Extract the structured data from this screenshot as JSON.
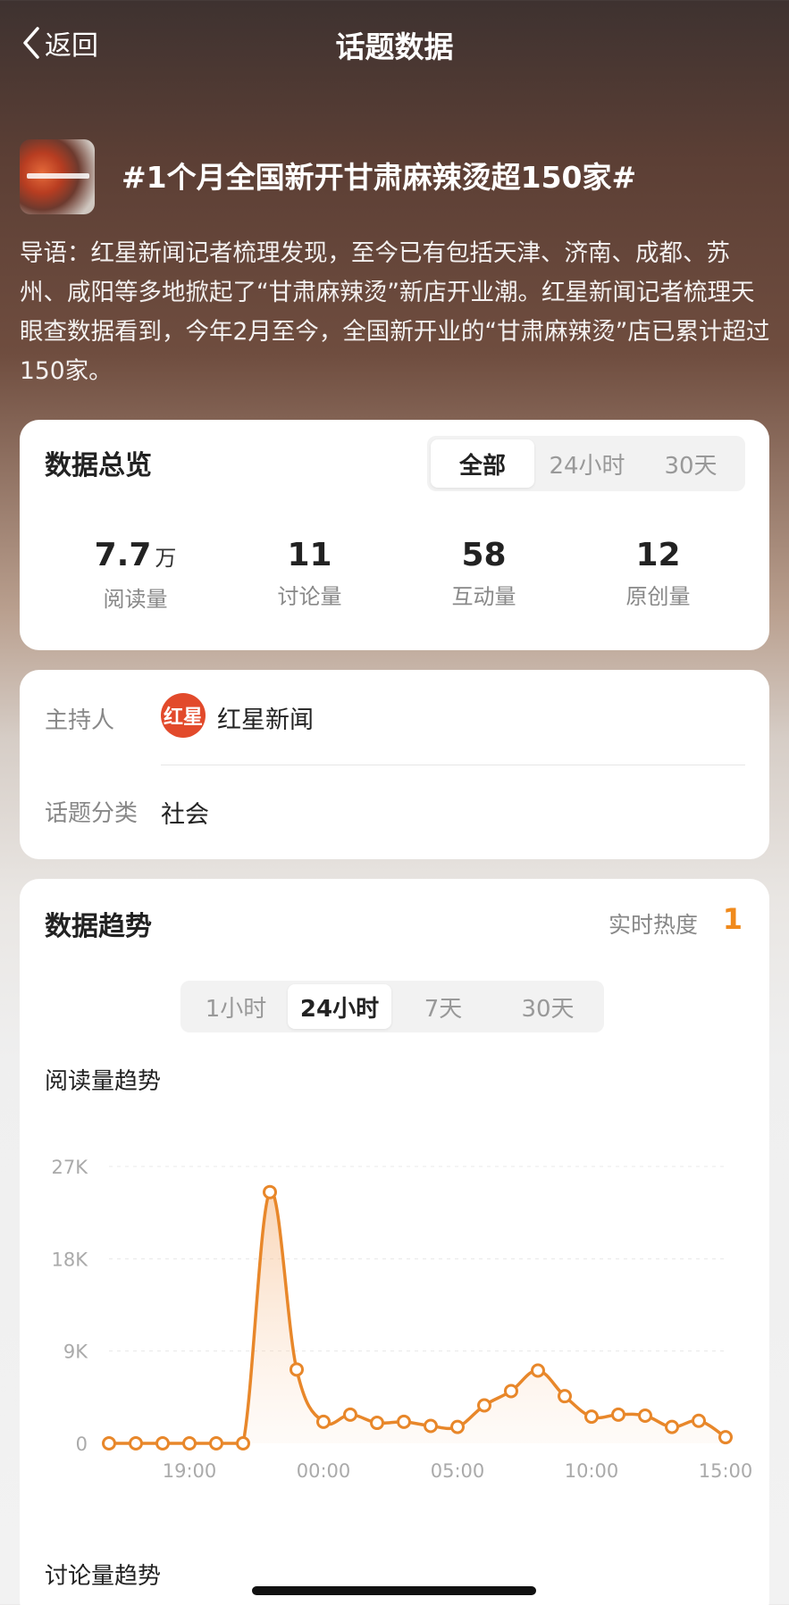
{
  "nav": {
    "back_label": "返回",
    "title": "话题数据"
  },
  "topic": {
    "title": "#1个月全国新开甘肃麻辣烫超150家#",
    "intro": "导语：红星新闻记者梳理发现，至今已有包括天津、济南、成都、苏州、咸阳等多地掀起了“甘肃麻辣烫”新店开业潮。红星新闻记者梳理天眼查数据看到，今年2月至今，全国新开业的“甘肃麻辣烫”店已累计超过150家。"
  },
  "overview": {
    "title": "数据总览",
    "tabs": [
      "全部",
      "24小时",
      "30天"
    ],
    "active_tab": "全部",
    "stats": [
      {
        "value": "7.7",
        "unit": "万",
        "label": "阅读量"
      },
      {
        "value": "11",
        "unit": "",
        "label": "讨论量"
      },
      {
        "value": "58",
        "unit": "",
        "label": "互动量"
      },
      {
        "value": "12",
        "unit": "",
        "label": "原创量"
      }
    ]
  },
  "host_info": {
    "host_label": "主持人",
    "host_logo_text": "红星",
    "host_name": "红星新闻",
    "category_label": "话题分类",
    "category_value": "社会"
  },
  "trend": {
    "title": "数据趋势",
    "heat_label": "实时热度",
    "heat_rank": "1",
    "tabs": [
      "1小时",
      "24小时",
      "7天",
      "30天"
    ],
    "active_tab": "24小时",
    "read_trend_title": "阅读量趋势",
    "discussion_trend_title": "讨论量趋势"
  },
  "colors": {
    "accent": "#f08a1c",
    "line": "#e8872a"
  },
  "chart_data": {
    "type": "area",
    "title": "阅读量趋势",
    "y_ticks": [
      "27K",
      "18K",
      "9K",
      "0"
    ],
    "ylim": [
      0,
      27000
    ],
    "x_tick_labels": [
      "19:00",
      "00:00",
      "05:00",
      "10:00",
      "15:00"
    ],
    "grid": true,
    "series": [
      {
        "values": [
          0,
          0,
          0,
          0,
          0,
          0,
          24500,
          7200,
          2100,
          2800,
          2000,
          2100,
          1700,
          1600,
          3700,
          5100,
          7100,
          4600,
          2600,
          2800,
          2700,
          1600,
          2200,
          600
        ]
      }
    ]
  }
}
